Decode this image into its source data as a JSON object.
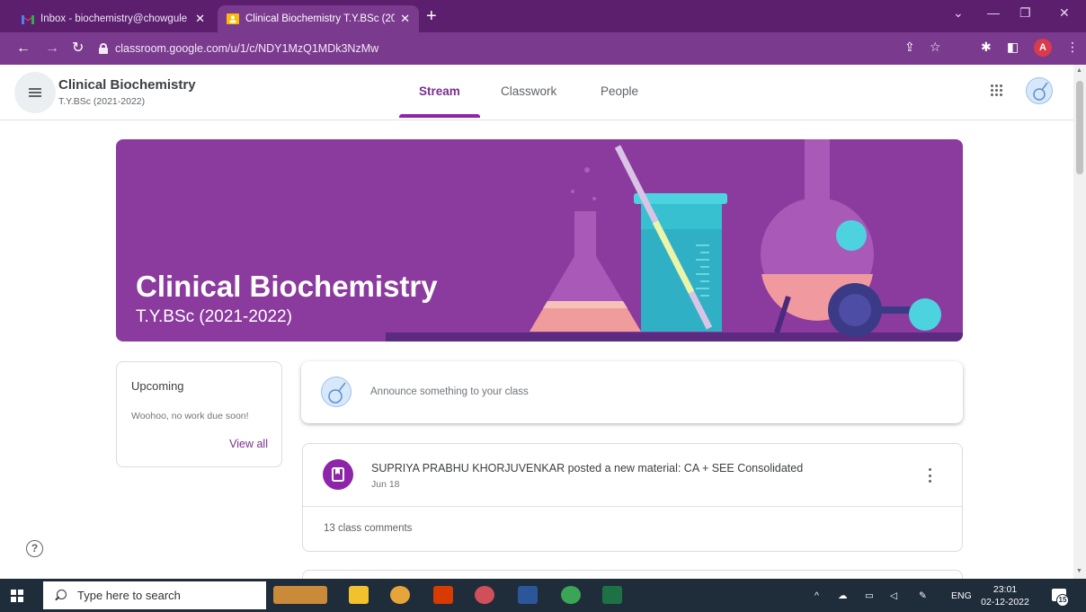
{
  "browser": {
    "tabs": [
      {
        "label": "Inbox - biochemistry@chowgule",
        "icon": "gmail-icon"
      },
      {
        "label": "Clinical Biochemistry T.Y.BSc (20",
        "icon": "classroom-icon"
      }
    ],
    "new_tab": "+",
    "url": "classroom.google.com/u/1/c/NDY1MzQ1MDk3NzMw",
    "profile_initial": "A",
    "colors": {
      "tabbar": "#5b1f6e",
      "toolbar": "#7a3a8d"
    }
  },
  "header": {
    "class_title": "Clinical Biochemistry",
    "class_subtitle": "T.Y.BSc (2021-2022)",
    "tabs": [
      {
        "label": "Stream",
        "active": true
      },
      {
        "label": "Classwork",
        "active": false
      },
      {
        "label": "People",
        "active": false
      }
    ]
  },
  "banner": {
    "title": "Clinical Biochemistry",
    "subtitle": "T.Y.BSc (2021-2022)",
    "color": "#8b3a9e"
  },
  "upcoming": {
    "title": "Upcoming",
    "message": "Woohoo, no work due soon!",
    "link": "View all"
  },
  "announce": {
    "placeholder": "Announce something to your class"
  },
  "post": {
    "title": "SUPRIYA PRABHU KHORJUVENKAR posted a new material: CA + SEE Consolidated",
    "date": "Jun 18",
    "comments": "13 class comments"
  },
  "help": "?",
  "taskbar": {
    "search_placeholder": "Type here to search",
    "language": "ENG",
    "time": "23:01",
    "date": "02-12-2022",
    "notifications": "15"
  },
  "accent": "#8e24aa"
}
